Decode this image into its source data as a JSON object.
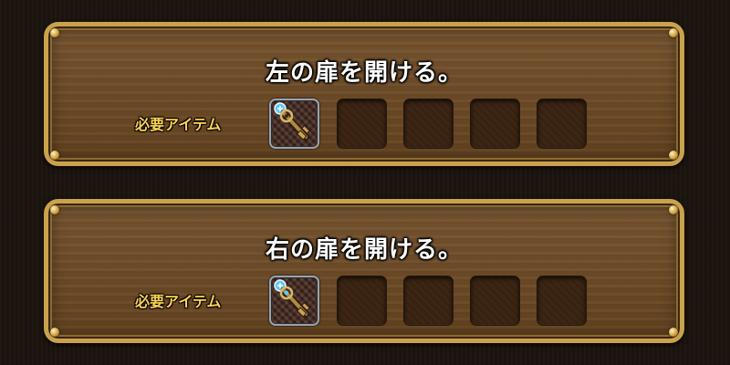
{
  "panels": [
    {
      "title": "左の扉を開ける。",
      "required_label": "必要アイテム",
      "slots": [
        "key-item",
        "empty",
        "empty",
        "empty",
        "empty"
      ]
    },
    {
      "title": "右の扉を開ける。",
      "required_label": "必要アイテム",
      "slots": [
        "key-item",
        "empty",
        "empty",
        "empty",
        "empty"
      ]
    }
  ],
  "colors": {
    "title": "#ffffff",
    "label": "#ffd454",
    "panel_border": "#caa24d",
    "panel_fill": "#6f4a23"
  }
}
